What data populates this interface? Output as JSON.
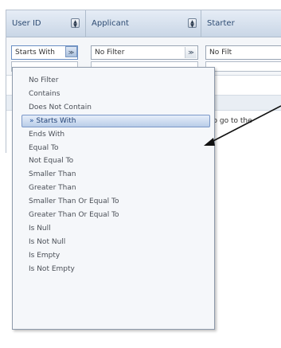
{
  "grid": {
    "columns": [
      {
        "label": "User ID"
      },
      {
        "label": "Applicant"
      },
      {
        "label": "Starter"
      }
    ],
    "filters": [
      {
        "value": "Starts With"
      },
      {
        "value": "No Filter"
      },
      {
        "value": "No Filt"
      }
    ],
    "hint_text": "to go to the"
  },
  "menu": {
    "selected_marker": "»",
    "selected_index": 3,
    "items": [
      "No Filter",
      "Contains",
      "Does Not Contain",
      "Starts With",
      "Ends With",
      "Equal To",
      "Not Equal To",
      "Smaller Than",
      "Greater Than",
      "Smaller Than Or Equal To",
      "Greater Than Or Equal To",
      "Is Null",
      "Is Not Null",
      "Is Empty",
      "Is Not Empty"
    ]
  },
  "icons": {
    "sort": "sort-arrows-icon",
    "dropdown": "double-chevron-down-icon",
    "annotation": "annotation-arrow-icon"
  },
  "colors": {
    "header_text": "#2e4c73",
    "selection_border": "#7b98c8",
    "annotation": "#111111"
  }
}
